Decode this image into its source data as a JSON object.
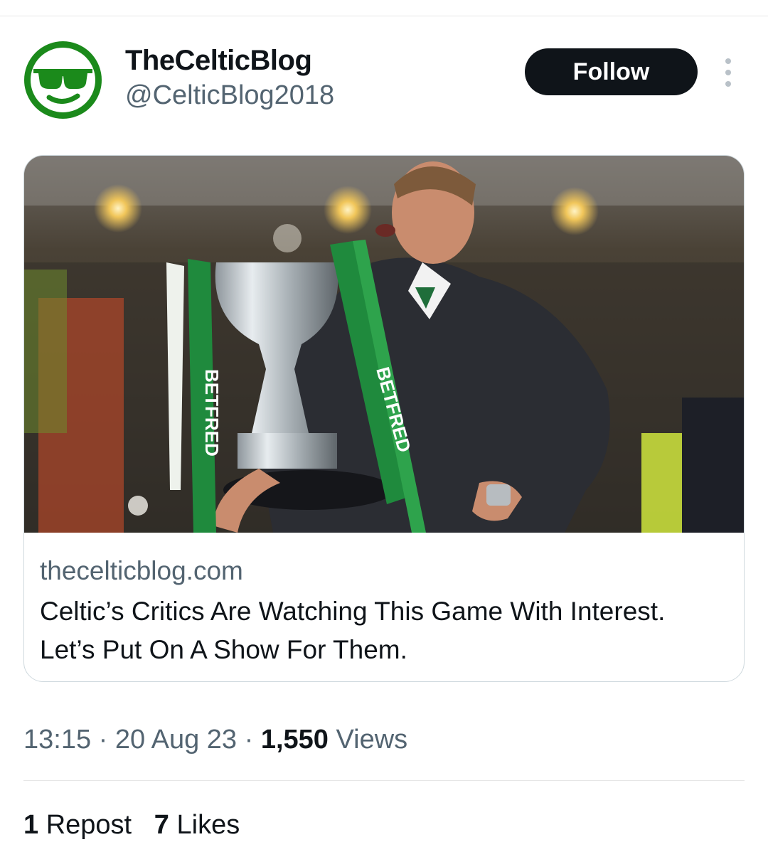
{
  "author": {
    "name": "TheCelticBlog",
    "handle": "@CelticBlog2018",
    "avatar_icon": "sunglasses-smiley-icon",
    "avatar_color": "#1b8a1b"
  },
  "actions": {
    "follow_label": "Follow",
    "more_icon": "more-vertical-icon"
  },
  "link_card": {
    "domain": "thecelticblog.com",
    "title": "Celtic’s Critics Are Watching This Game With Interest. Let’s Put On A Show For Them.",
    "image": {
      "subject": "manager-holding-trophy",
      "ribbon_text": "BETFRED"
    }
  },
  "meta": {
    "time": "13:15",
    "separator": "·",
    "date": "20 Aug 23",
    "views_count": "1,550",
    "views_label": "Views"
  },
  "stats": {
    "reposts_count": "1",
    "reposts_label": "Repost",
    "likes_count": "7",
    "likes_label": "Likes"
  },
  "colors": {
    "text_primary": "#0f1419",
    "text_secondary": "#536471",
    "follow_bg": "#0f1419",
    "celtic_green": "#1b8a1b"
  }
}
